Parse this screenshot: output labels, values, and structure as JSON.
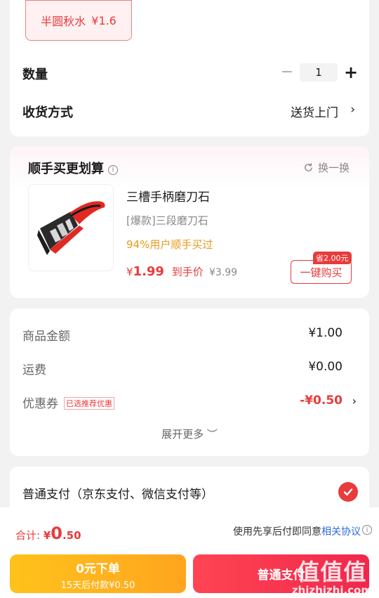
{
  "spec": {
    "name": "半圆秋水",
    "price": "¥1.6"
  },
  "quantity": {
    "label": "数量",
    "minus": "−",
    "value": "1",
    "plus": "+"
  },
  "shipping": {
    "label": "收货方式",
    "value": "送货上门",
    "arrow": "›"
  },
  "addon": {
    "title": "顺手买更划算",
    "info_icon": "i",
    "refresh": "换一换",
    "product": {
      "name": "三槽手柄磨刀石",
      "subtitle": "[爆款]三段磨刀石",
      "rate": "94%用户顺手买过",
      "currency": "¥",
      "price": "1.99",
      "price_tag": "到手价",
      "original": "¥3.99",
      "save_badge": "省2.00元",
      "buy": "一键购买"
    }
  },
  "costs": {
    "goods_label": "商品金额",
    "goods_value": "¥1.00",
    "freight_label": "运费",
    "freight_value": "¥0.00",
    "coupon_label": "优惠券",
    "coupon_tag": "已选推荐优惠",
    "coupon_value": "-¥0.50",
    "coupon_arrow": "›",
    "expand": "展开更多 ︶"
  },
  "payment": {
    "label": "普通支付（京东支付、微信支付等）"
  },
  "bottom": {
    "total_label": "合计:",
    "total_currency": "¥",
    "total_int": "0",
    "total_dec": ".50",
    "agree_text": "使用先享后付即同意",
    "agree_link": "相关协议",
    "info_icon": "i",
    "pay_later_title": "0元下单",
    "pay_later_sub": "15天后付款¥0.50",
    "normal_pay": "普通支付",
    "watermark_big": "值值值",
    "watermark_small": "zhizhizhi.com"
  },
  "colors": {
    "accent": "#e83b3b",
    "link": "#2e6cd6",
    "yellow": "#ffb31e"
  },
  "icons": [
    "minus-icon",
    "plus-icon",
    "chevron-right-icon",
    "info-icon",
    "refresh-icon",
    "check-icon",
    "knife-sharpener-image"
  ]
}
